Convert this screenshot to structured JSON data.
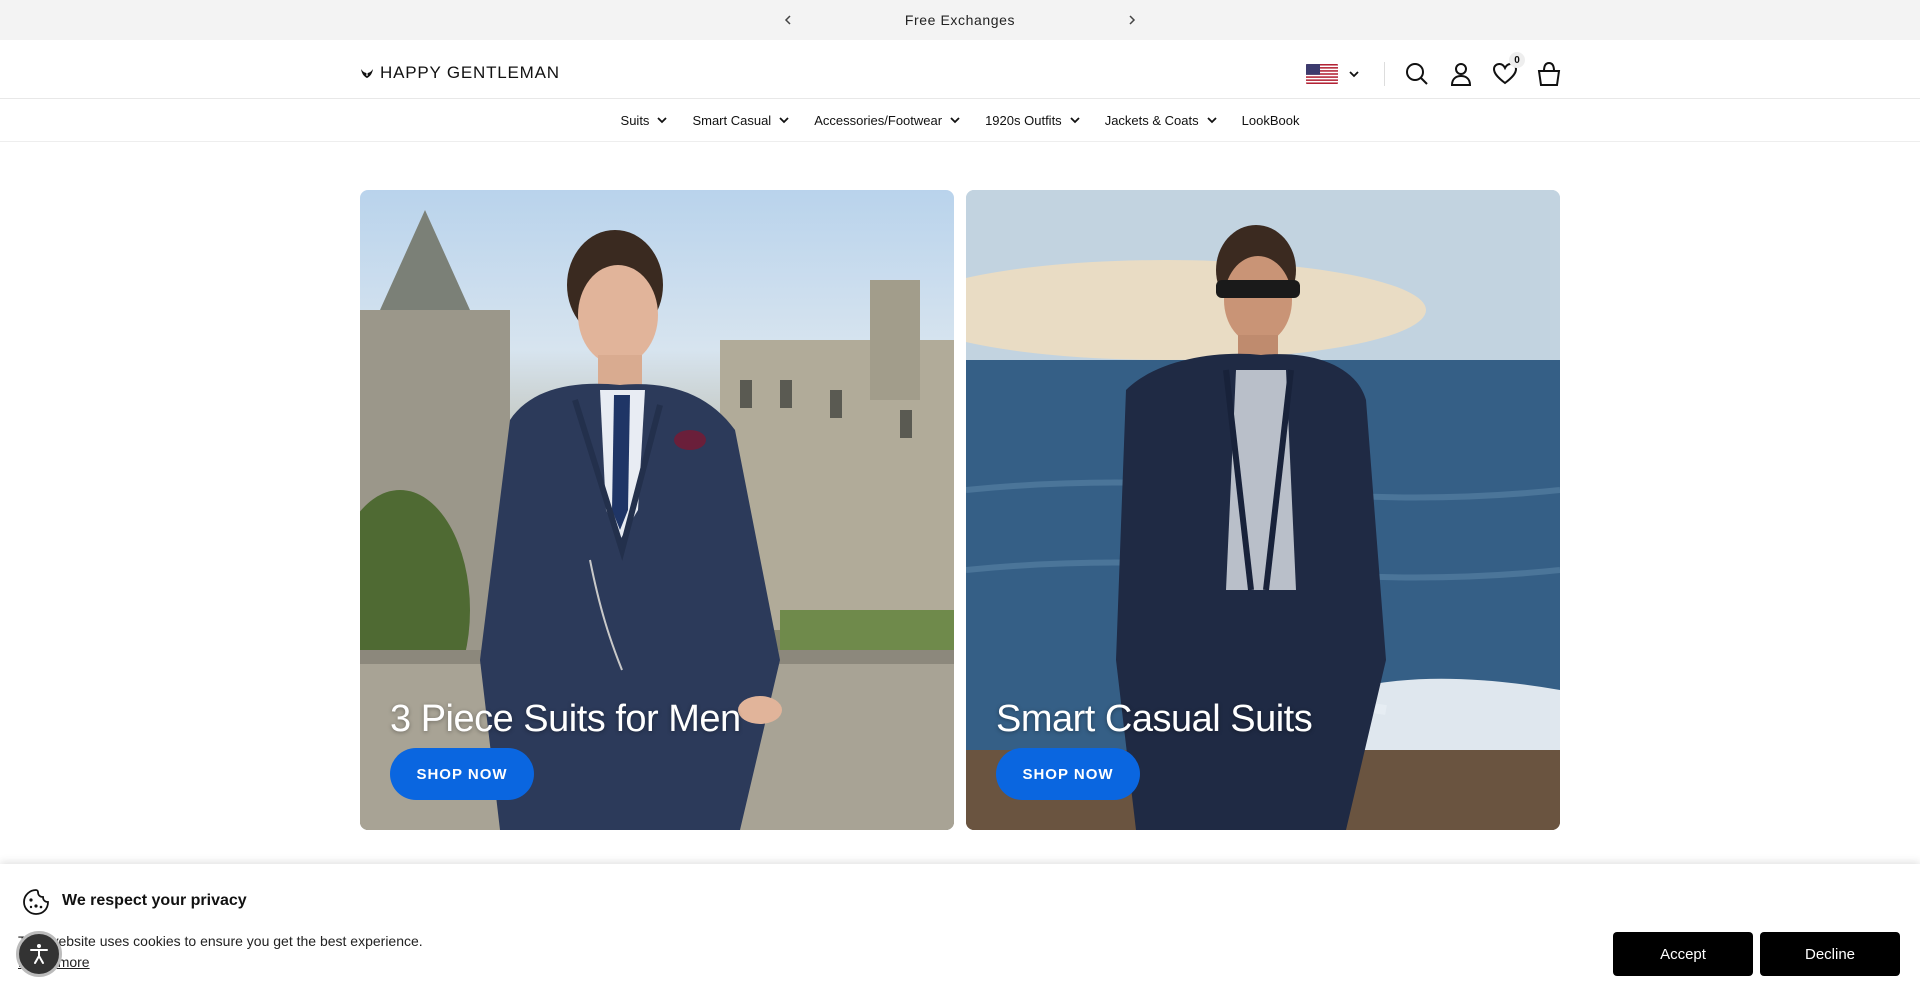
{
  "announcement": {
    "text": "Free Exchanges",
    "prev_icon": "chevron-left-icon",
    "next_icon": "chevron-right-icon"
  },
  "header": {
    "logo_text": "HAPPY GENTLEMAN",
    "country_flag": "us-flag",
    "wishlist_count": "0",
    "icons": [
      "search-icon",
      "account-icon",
      "heart-icon",
      "bag-icon"
    ]
  },
  "nav": {
    "items": [
      {
        "label": "Suits",
        "has_dropdown": true
      },
      {
        "label": "Smart Casual",
        "has_dropdown": true
      },
      {
        "label": "Accessories/Footwear",
        "has_dropdown": true
      },
      {
        "label": "1920s Outfits",
        "has_dropdown": true
      },
      {
        "label": "Jackets & Coats",
        "has_dropdown": true
      },
      {
        "label": "LookBook",
        "has_dropdown": false
      }
    ]
  },
  "hero": {
    "cards": [
      {
        "title": "3 Piece Suits for Men",
        "button": "SHOP NOW"
      },
      {
        "title": "Smart Casual Suits",
        "button": "SHOP NOW"
      }
    ]
  },
  "cookie": {
    "title": "We respect your privacy",
    "body": "This website uses cookies to ensure you get the best experience.",
    "link": "Learn more",
    "accept": "Accept",
    "decline": "Decline"
  },
  "colors": {
    "accent": "#0a66e0",
    "announce_bg": "#f3f3f3",
    "button_dark": "#000000"
  }
}
